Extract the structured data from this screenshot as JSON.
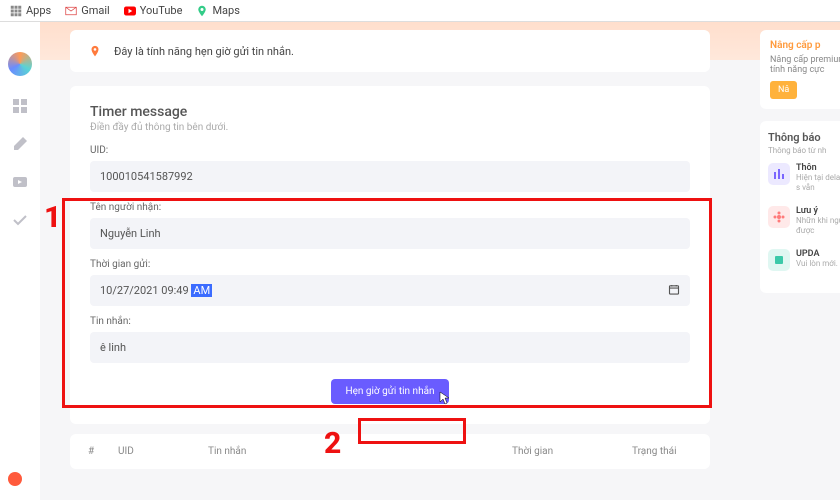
{
  "bookmarks": {
    "apps": "Apps",
    "gmail": "Gmail",
    "youtube": "YouTube",
    "maps": "Maps"
  },
  "banner": {
    "text": "Đây là tính năng hẹn giờ gửi tin nhắn."
  },
  "card": {
    "title": "Timer message",
    "subtitle": "Điền đầy đủ thông tin bên dưới."
  },
  "fields": {
    "uid_label": "UID:",
    "uid_value": "100010541587992",
    "recipient_label": "Tên người nhận:",
    "recipient_value": "Nguyễn Linh",
    "time_label": "Thời gian gửi:",
    "time_value_date": "10/27/2021 09:49",
    "time_value_ampm": "AM",
    "message_label": "Tin nhắn:",
    "message_value": "ê linh"
  },
  "submit": {
    "label": "Hẹn giờ gửi tin nhắn"
  },
  "annotations": {
    "one": "1",
    "two": "2"
  },
  "table": {
    "h1": "#",
    "h2": "UID",
    "h3": "Tin nhắn",
    "h4": "Thời gian",
    "h5": "Trạng thái"
  },
  "right": {
    "upgrade_title": "Nâng cấp p",
    "upgrade_text": "Nâng cấp premium, tính năng cực",
    "upgrade_btn": "Nâ",
    "notif_title": "Thông báo",
    "notif_sub": "Thông báo từ nh",
    "items": [
      {
        "title": "Thôn",
        "text": "Hiện tại delay phút s vẫn"
      },
      {
        "title": "Lưu ý",
        "text": "Nhữn khi ngư được"
      },
      {
        "title": "UPDA",
        "text": "Vui lòn mới. X"
      }
    ]
  }
}
